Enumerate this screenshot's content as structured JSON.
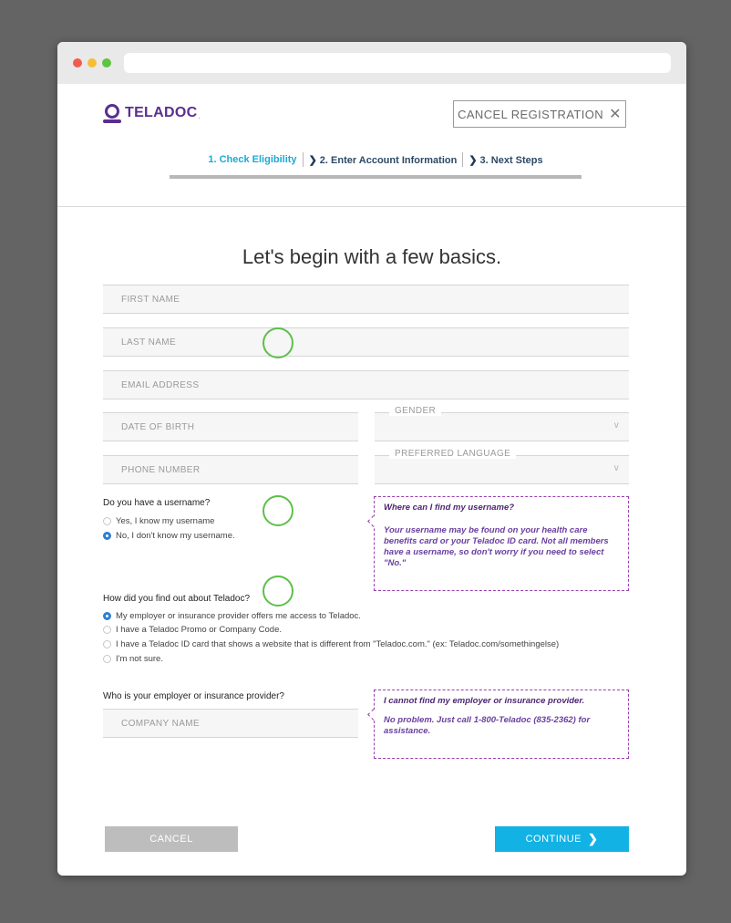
{
  "brand": {
    "name": "TELADOC",
    "tm": "."
  },
  "header": {
    "cancel_registration": "CANCEL REGISTRATION",
    "steps": [
      {
        "label": "1. Check Eligibility",
        "active": true
      },
      {
        "label": "2. Enter Account Information",
        "active": false
      },
      {
        "label": "3. Next Steps",
        "active": false
      }
    ]
  },
  "form": {
    "heading": "Let's begin with a few basics.",
    "first_name": {
      "placeholder": "FIRST NAME",
      "value": ""
    },
    "last_name": {
      "placeholder": "LAST NAME",
      "value": ""
    },
    "email": {
      "placeholder": "EMAIL ADDRESS",
      "value": ""
    },
    "dob": {
      "placeholder": "DATE OF BIRTH",
      "value": ""
    },
    "phone": {
      "placeholder": "PHONE NUMBER",
      "value": ""
    },
    "gender": {
      "label": "GENDER",
      "value": ""
    },
    "language": {
      "label": "PREFERRED LANGUAGE",
      "value": ""
    },
    "username_question": "Do you have a username?",
    "username_options": [
      {
        "label": "Yes, I know my username",
        "selected": false
      },
      {
        "label": "No, I don't know my username.",
        "selected": true
      }
    ],
    "username_tip": {
      "title": "Where can I find my username?",
      "body": "Your username may be found on your health care benefits card or your Teladoc ID card. Not all members have a username, so don't worry if you need to select \"No.\""
    },
    "source_question": "How did you find out about Teladoc?",
    "source_options": [
      {
        "label": "My employer or insurance provider offers me access to Teladoc.",
        "selected": true
      },
      {
        "label": "I have a Teladoc Promo or Company Code.",
        "selected": false
      },
      {
        "label": "I have a Teladoc ID card that shows a website that is different from \"Teladoc.com.\" (ex: Teladoc.com/somethingelse)",
        "selected": false
      },
      {
        "label": "I'm not sure.",
        "selected": false
      }
    ],
    "employer_question": "Who is your employer or insurance provider?",
    "company": {
      "placeholder": "COMPANY NAME",
      "value": ""
    },
    "employer_tip": {
      "title": "I cannot find my employer or insurance provider.",
      "body": "No problem. Just call 1-800-Teladoc (835-2362) for assistance."
    }
  },
  "actions": {
    "cancel": "CANCEL",
    "continue": "CONTINUE"
  },
  "colors": {
    "brand": "#5b2d90",
    "accent": "#12b2e4",
    "highlight_circle": "#5dc04a"
  }
}
